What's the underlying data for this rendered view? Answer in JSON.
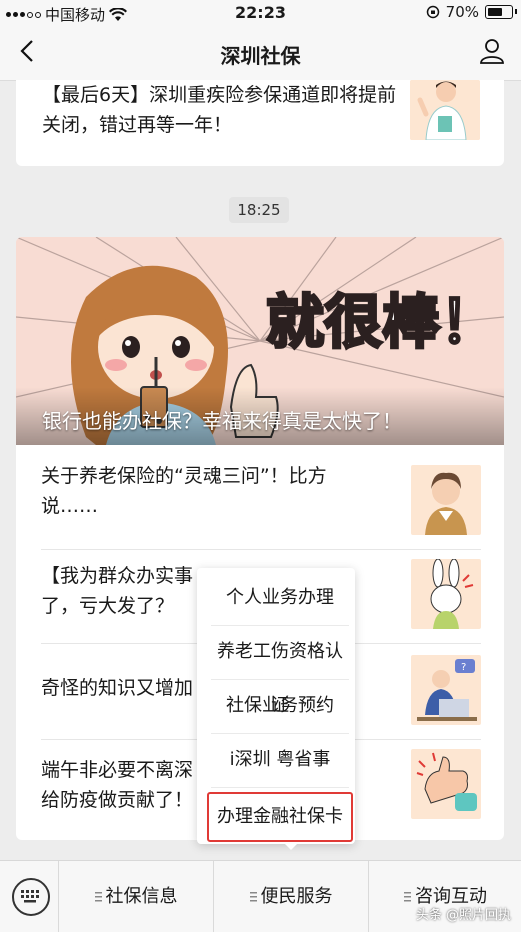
{
  "status_bar": {
    "carrier": "中国移动",
    "time": "22:23",
    "battery_percent": "70%"
  },
  "nav": {
    "title": "深圳社保"
  },
  "top_article": {
    "text": "【最后6天】深圳重疾险参保通道即将提前关闭，错过再等一年！"
  },
  "timestamp": "18:25",
  "hero": {
    "caption": "银行也能办社保？幸福来得真是太快了！",
    "art_text": "就很棒！"
  },
  "articles": [
    {
      "text": "关于养老保险的“灵魂三问”！比方说……"
    },
    {
      "text": "【我为群众办实事"
    },
    {
      "text": "了，亏大发了？"
    },
    {
      "text": "奇怪的知识又增加"
    },
    {
      "text": "端午非必要不离深"
    },
    {
      "text": "给防疫做贡献了！"
    }
  ],
  "menu": {
    "items": [
      "个人业务办理",
      "养老工伤资格认证",
      "社保业务预约",
      "i深圳 粤省事",
      "办理金融社保卡"
    ]
  },
  "bottom_tabs": [
    "社保信息",
    "便民服务",
    "咨询互动"
  ],
  "watermark": "头条 @照片回执"
}
